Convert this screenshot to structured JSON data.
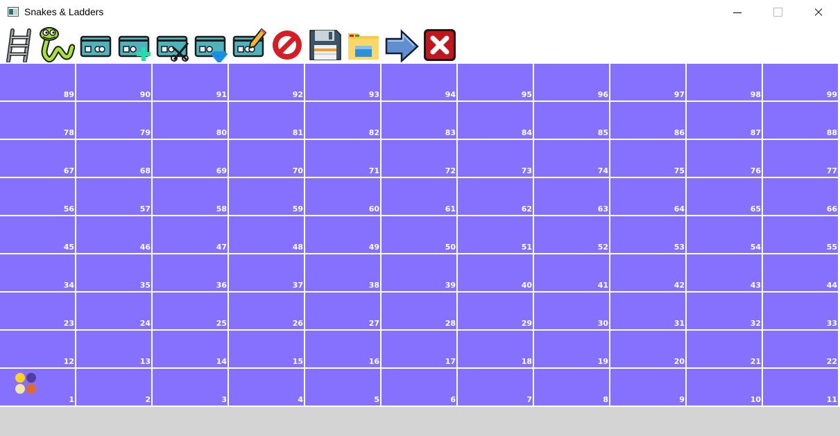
{
  "window": {
    "title": "Snakes & Ladders",
    "controls": [
      "minimize",
      "maximize",
      "close"
    ]
  },
  "toolbar": {
    "buttons": [
      {
        "name": "ladder-icon"
      },
      {
        "name": "snake-icon"
      },
      {
        "name": "card-icon"
      },
      {
        "name": "card-add-icon"
      },
      {
        "name": "card-cut-icon"
      },
      {
        "name": "card-download-icon"
      },
      {
        "name": "card-edit-icon"
      },
      {
        "name": "no-entry-icon"
      },
      {
        "name": "save-icon"
      },
      {
        "name": "open-folder-icon"
      },
      {
        "name": "arrow-right-icon"
      },
      {
        "name": "exit-icon"
      }
    ]
  },
  "board": {
    "columns": 11,
    "rows": [
      [
        89,
        90,
        91,
        92,
        93,
        94,
        95,
        96,
        97,
        98,
        99
      ],
      [
        78,
        79,
        80,
        81,
        82,
        83,
        84,
        85,
        86,
        87,
        88
      ],
      [
        67,
        68,
        69,
        70,
        71,
        72,
        73,
        74,
        75,
        76,
        77
      ],
      [
        56,
        57,
        58,
        59,
        60,
        61,
        62,
        63,
        64,
        65,
        66
      ],
      [
        45,
        46,
        47,
        48,
        49,
        50,
        51,
        52,
        53,
        54,
        55
      ],
      [
        34,
        35,
        36,
        37,
        38,
        39,
        40,
        41,
        42,
        43,
        44
      ],
      [
        23,
        24,
        25,
        26,
        27,
        28,
        29,
        30,
        31,
        32,
        33
      ],
      [
        12,
        13,
        14,
        15,
        16,
        17,
        18,
        19,
        20,
        21,
        22
      ],
      [
        1,
        2,
        3,
        4,
        5,
        6,
        7,
        8,
        9,
        10,
        11
      ]
    ],
    "cell_color": "#8671ff",
    "pieces_on_square": 1,
    "pieces": [
      {
        "color": "#ffd21e"
      },
      {
        "color": "#4f3f9a"
      },
      {
        "color": "#f4e6a6"
      },
      {
        "color": "#e06a2a"
      }
    ]
  }
}
